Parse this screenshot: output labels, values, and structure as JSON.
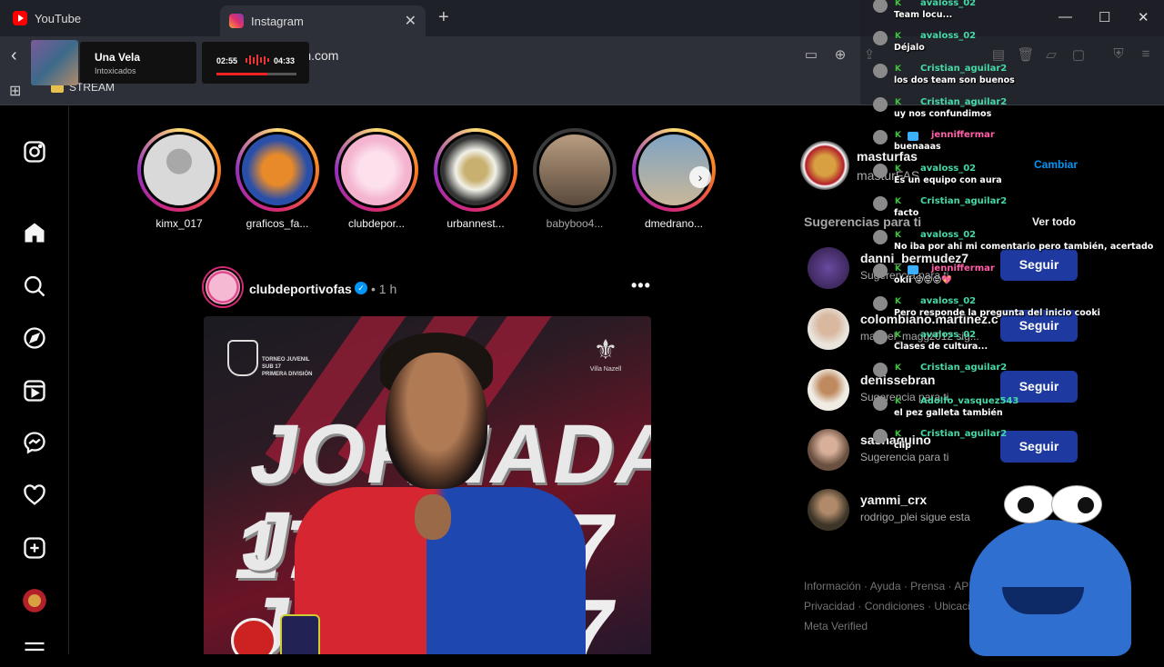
{
  "browser": {
    "tabs": [
      {
        "label": "YouTube",
        "icon": "youtube-icon"
      },
      {
        "label": "Instagram",
        "icon": "instagram-icon",
        "active": true
      }
    ],
    "url": "ram.com",
    "bookmark_folder": "STREAM"
  },
  "music": {
    "title": "Una Vela",
    "artist": "Intoxicados",
    "current": "02:55",
    "total": "04:33",
    "progress": 0.64
  },
  "stories": [
    {
      "label": "kimx_017",
      "seen": false,
      "color": "#d9d9d9"
    },
    {
      "label": "graficos_fa...",
      "seen": false,
      "color": "#2a4fa8"
    },
    {
      "label": "clubdepor...",
      "seen": false,
      "color": "#f4b3cf"
    },
    {
      "label": "urbannest...",
      "seen": false,
      "color": "#f2f2ea"
    },
    {
      "label": "babyboo4...",
      "seen": true,
      "color": "#8c7a6a"
    },
    {
      "label": "dmedrano...",
      "seen": false,
      "color": "#7fa3c2"
    }
  ],
  "post": {
    "user": "clubdeportivofas",
    "time": "1 h",
    "image_text": {
      "line1": "JORNADA 17",
      "line2": "JO",
      "line3": "JO",
      "num1": "17",
      "tournament": "TORNEO JUVENIL\nSUB 17\nPRIMERA DIVISIÓN",
      "sponsor": "Villa Nazell"
    }
  },
  "profile": {
    "user": "masturfas",
    "sub": "masturFAS",
    "switch_label": "Cambiar"
  },
  "suggestions": {
    "title": "Sugerencias para ti",
    "see_all": "Ver todo",
    "items": [
      {
        "name": "danni_bermudez7",
        "sub": "Sugerencia para ti",
        "button": "Seguir",
        "color": "#4a3a6a"
      },
      {
        "name": "colombiano.martinez.c",
        "sub": "manuel_maggz012 sig...",
        "button": "Seguir",
        "color": "#c9c2b8"
      },
      {
        "name": "denissebran",
        "sub": "Sugerencia para ti",
        "button": "Seguir",
        "color": "#8a5a40"
      },
      {
        "name": "sashaquino",
        "sub": "Sugerencia para ti",
        "button": "Seguir",
        "color": "#c8a890"
      },
      {
        "name": "yammi_crx",
        "sub": "rodrigo_plei sigue esta",
        "button": "",
        "color": "#3d3528"
      }
    ]
  },
  "footer": {
    "line1": "Información · Ayuda · Prensa · API",
    "line2": "Privacidad · Condiciones · Ubicacio",
    "line3": "Meta Verified"
  },
  "chat": [
    {
      "user": "avaloss_02",
      "text": "Team locu..."
    },
    {
      "user": "avaloss_02",
      "text": "Déjalo"
    },
    {
      "user": "Cristian_aguilar2",
      "text": "los dos team son buenos"
    },
    {
      "user": "Cristian_aguilar2",
      "text": "uy nos confundimos"
    },
    {
      "user": "jenniffermar",
      "text": "buenaaas",
      "pink": true
    },
    {
      "user": "avaloss_02",
      "text": "Es un equipo con aura"
    },
    {
      "user": "Cristian_aguilar2",
      "text": "facto"
    },
    {
      "user": "avaloss_02",
      "text": "No iba por ahi mi comentario pero también, acertado"
    },
    {
      "user": "jenniffermar",
      "text": "okii 😝😝😝💖",
      "pink": true
    },
    {
      "user": "avaloss_02",
      "text": "Pero responde la pregunta del inicio cooki"
    },
    {
      "user": "avaloss_02",
      "text": "Clases de cultura..."
    },
    {
      "user": "Cristian_aguilar2",
      "text": ""
    },
    {
      "user": "Adolfo_vasquez543",
      "text": "el pez galleta también"
    },
    {
      "user": "Cristian_aguilar2",
      "text": "clip"
    }
  ]
}
